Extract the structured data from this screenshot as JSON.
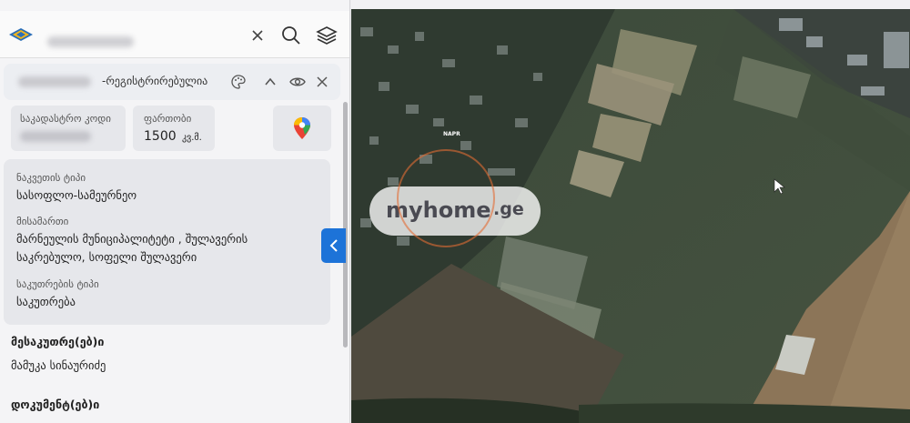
{
  "panel": {
    "card": {
      "title": "-რეგისტრირებულია"
    },
    "cadastral": {
      "label": "საკადასტრო კოდი",
      "value": ""
    },
    "area": {
      "label": "ფართობი",
      "value": "1500",
      "unit": "კვ.მ."
    },
    "info": {
      "type_label": "ნაკვეთის ტიპი",
      "type_value": "სასოფლო-სამეურნეო",
      "address_label": "მისამართი",
      "address_line1": "მარნეულის მუნიციპალიტეტი , შულავერის",
      "address_line2": "საკრებულო, სოფელი შულავერი",
      "property_label": "საკუთრების ტიპი",
      "property_value": "საკუთრება"
    },
    "owners_heading": "მესაკუთრე(ებ)ი",
    "owner_name": "მამუკა სინაურიძე",
    "documents_heading": "დოკუმენტ(ებ)ი"
  },
  "map": {
    "label": "NAPR",
    "watermark": "myhome",
    "watermark_suffix": ".ge"
  },
  "colors": {
    "accent": "#1d73d8",
    "panel_bg": "#f4f4f6",
    "box_bg": "#e6e7eb"
  }
}
